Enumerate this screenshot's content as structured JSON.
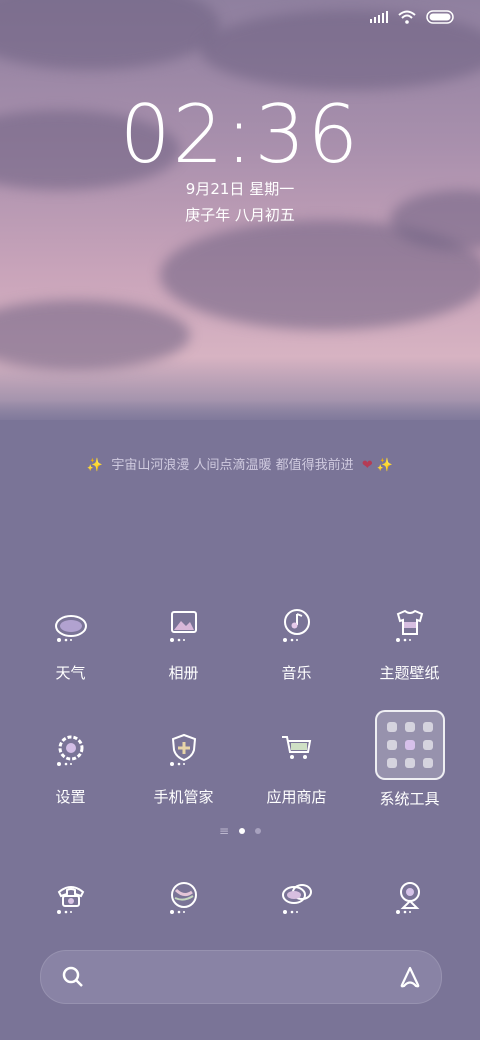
{
  "status_bar": {
    "icons": [
      "signal-icon",
      "wifi-icon",
      "battery-icon"
    ]
  },
  "lockscreen": {
    "time": "02:36",
    "date": "9月21日 星期一",
    "lunar_date": "庚子年 八月初五"
  },
  "widget": {
    "quote": "宇宙山河浪漫 人间点滴温暖 都值得我前进",
    "spark": "✨",
    "heart": "❤"
  },
  "apps": [
    {
      "label": "天气",
      "icon": "weather-icon"
    },
    {
      "label": "相册",
      "icon": "gallery-icon"
    },
    {
      "label": "音乐",
      "icon": "music-icon"
    },
    {
      "label": "主题壁纸",
      "icon": "themes-icon"
    },
    {
      "label": "设置",
      "icon": "settings-icon"
    },
    {
      "label": "手机管家",
      "icon": "security-icon"
    },
    {
      "label": "应用商店",
      "icon": "app-store-icon"
    },
    {
      "label": "系统工具",
      "icon": "folder-icon"
    }
  ],
  "pager": {
    "menu_glyph": "≡",
    "pages": 2,
    "active": 1
  },
  "dock": [
    {
      "icon": "phone-icon"
    },
    {
      "icon": "browser-icon"
    },
    {
      "icon": "messages-icon"
    },
    {
      "icon": "camera-icon"
    }
  ],
  "search": {
    "placeholder": "",
    "icons": [
      "search-icon",
      "assistant-icon"
    ]
  },
  "colors": {
    "background": "#7a7497",
    "accent": "#ffffff"
  }
}
